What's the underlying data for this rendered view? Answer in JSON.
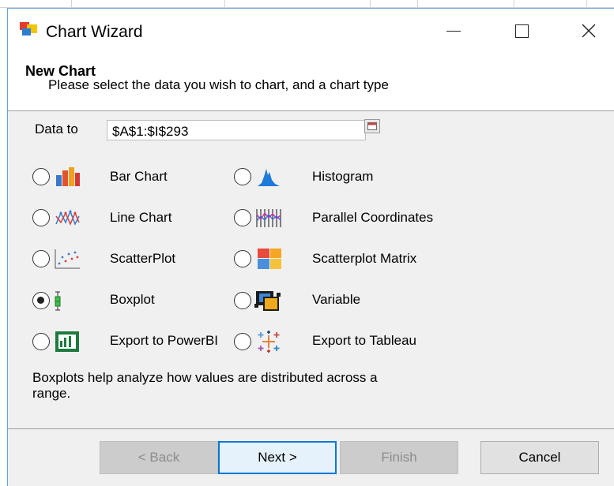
{
  "window": {
    "title": "Chart Wizard",
    "accent_color": "#0078d7"
  },
  "header": {
    "title": "New Chart",
    "subtitle": "Please select the data you wish to chart, and a chart type"
  },
  "data_range": {
    "label": "Data to",
    "value": "$A$1:$I$293",
    "picker_icon": "range-picker-icon"
  },
  "chart_types": [
    {
      "label": "Bar Chart",
      "icon": "bar-chart-icon",
      "selected": false
    },
    {
      "label": "Histogram",
      "icon": "histogram-icon",
      "selected": false
    },
    {
      "label": "Line Chart",
      "icon": "line-chart-icon",
      "selected": false
    },
    {
      "label": "Parallel Coordinates",
      "icon": "parallel-coordinates-icon",
      "selected": false
    },
    {
      "label": "ScatterPlot",
      "icon": "scatterplot-icon",
      "selected": false
    },
    {
      "label": "Scatterplot Matrix",
      "icon": "scatterplot-matrix-icon",
      "selected": false
    },
    {
      "label": "Boxplot",
      "icon": "boxplot-icon",
      "selected": true
    },
    {
      "label": "Variable",
      "icon": "variable-icon",
      "selected": false
    },
    {
      "label": "Export to PowerBI",
      "icon": "powerbi-icon",
      "selected": false
    },
    {
      "label": "Export to Tableau",
      "icon": "tableau-icon",
      "selected": false
    }
  ],
  "description": "Boxplots help analyze how values are distributed across a range.",
  "buttons": {
    "back": "< Back",
    "next": "Next >",
    "finish": "Finish",
    "cancel": "Cancel"
  }
}
